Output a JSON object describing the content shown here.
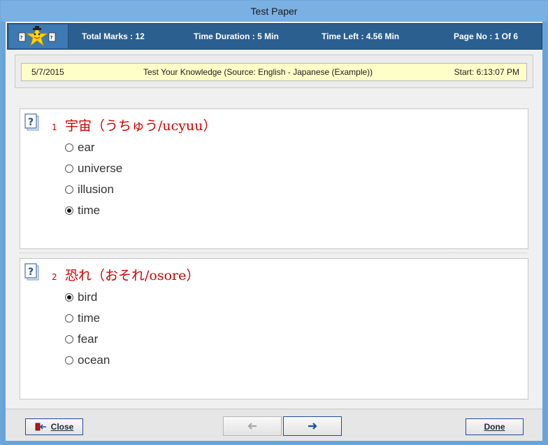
{
  "window": {
    "title": "Test Paper"
  },
  "infobar": {
    "total_marks": "Total Marks : 12",
    "time_duration": "Time Duration : 5  Min",
    "time_left": "Time Left : 4.56  Min",
    "page_no": "Page No : 1 Of 6"
  },
  "datebar": {
    "date": "5/7/2015",
    "title": "Test Your Knowledge  (Source: English - Japanese  (Example))",
    "start": "Start: 6:13:07 PM"
  },
  "questions": [
    {
      "number": "1",
      "text": "宇宙（うちゅう/ucyuu）",
      "options": [
        {
          "label": "ear",
          "selected": false
        },
        {
          "label": "universe",
          "selected": false
        },
        {
          "label": "illusion",
          "selected": false
        },
        {
          "label": "time",
          "selected": true
        }
      ]
    },
    {
      "number": "2",
      "text": "恐れ（おそれ/osore）",
      "options": [
        {
          "label": "bird",
          "selected": true
        },
        {
          "label": "time",
          "selected": false
        },
        {
          "label": "fear",
          "selected": false
        },
        {
          "label": "ocean",
          "selected": false
        }
      ]
    }
  ],
  "footer": {
    "close_label": "Close",
    "done_label": "Done"
  },
  "colors": {
    "accent": "#2a5f8f",
    "question_text": "#cc0000",
    "date_bar_bg": "#fefec8"
  },
  "icons": [
    "logo-star-icon",
    "question-icon",
    "close-door-icon",
    "arrow-left-icon",
    "arrow-right-icon"
  ]
}
